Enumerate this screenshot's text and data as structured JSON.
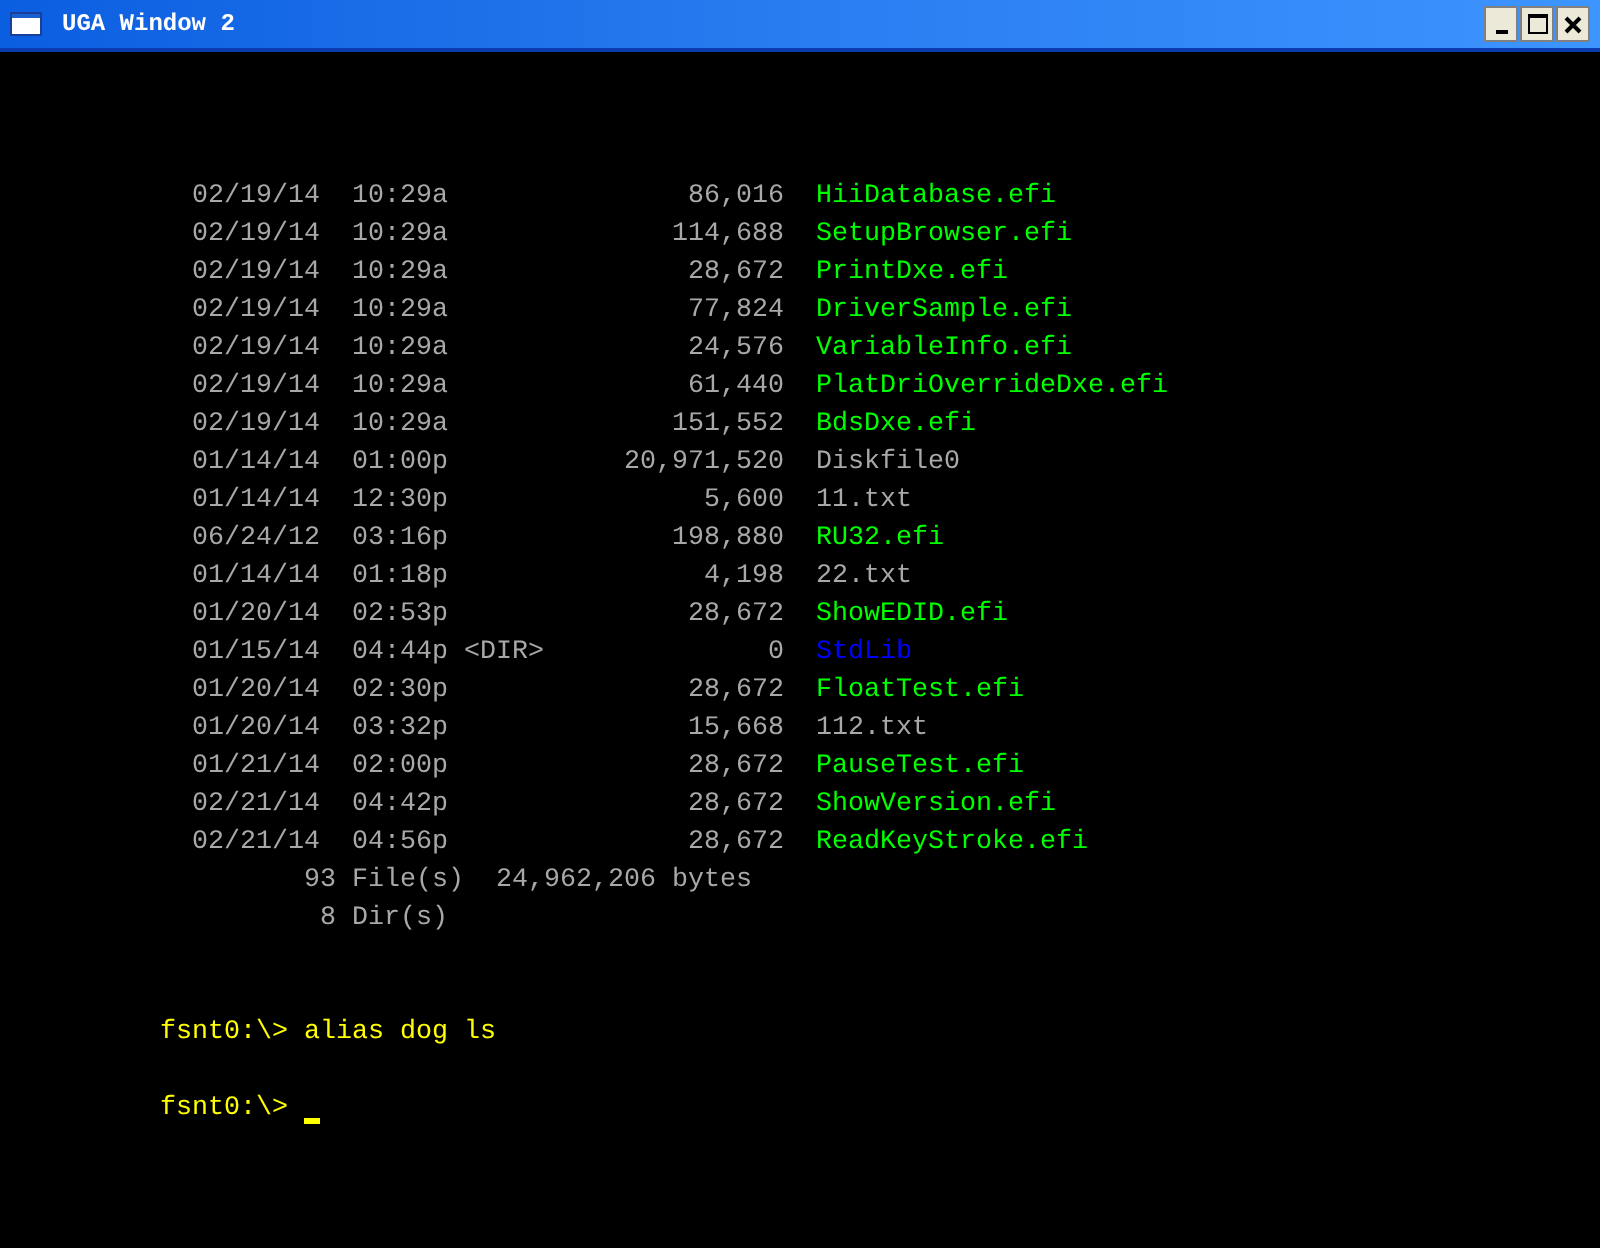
{
  "window": {
    "title": "UGA Window 2"
  },
  "listing": [
    {
      "date": "02/19/14",
      "time": "10:29a",
      "size": "86,016",
      "name": "HiiDatabase.efi",
      "kind": "executable"
    },
    {
      "date": "02/19/14",
      "time": "10:29a",
      "size": "114,688",
      "name": "SetupBrowser.efi",
      "kind": "executable"
    },
    {
      "date": "02/19/14",
      "time": "10:29a",
      "size": "28,672",
      "name": "PrintDxe.efi",
      "kind": "executable"
    },
    {
      "date": "02/19/14",
      "time": "10:29a",
      "size": "77,824",
      "name": "DriverSample.efi",
      "kind": "executable"
    },
    {
      "date": "02/19/14",
      "time": "10:29a",
      "size": "24,576",
      "name": "VariableInfo.efi",
      "kind": "executable"
    },
    {
      "date": "02/19/14",
      "time": "10:29a",
      "size": "61,440",
      "name": "PlatDriOverrideDxe.efi",
      "kind": "executable"
    },
    {
      "date": "02/19/14",
      "time": "10:29a",
      "size": "151,552",
      "name": "BdsDxe.efi",
      "kind": "executable"
    },
    {
      "date": "01/14/14",
      "time": "01:00p",
      "size": "20,971,520",
      "name": "Diskfile0",
      "kind": "file"
    },
    {
      "date": "01/14/14",
      "time": "12:30p",
      "size": "5,600",
      "name": "11.txt",
      "kind": "file"
    },
    {
      "date": "06/24/12",
      "time": "03:16p",
      "size": "198,880",
      "name": "RU32.efi",
      "kind": "executable"
    },
    {
      "date": "01/14/14",
      "time": "01:18p",
      "size": "4,198",
      "name": "22.txt",
      "kind": "file"
    },
    {
      "date": "01/20/14",
      "time": "02:53p",
      "size": "28,672",
      "name": "ShowEDID.efi",
      "kind": "executable"
    },
    {
      "date": "01/15/14",
      "time": "04:44p",
      "dir_tag": "<DIR>",
      "size": "0",
      "name": "StdLib",
      "kind": "directory"
    },
    {
      "date": "01/20/14",
      "time": "02:30p",
      "size": "28,672",
      "name": "FloatTest.efi",
      "kind": "executable"
    },
    {
      "date": "01/20/14",
      "time": "03:32p",
      "size": "15,668",
      "name": "112.txt",
      "kind": "file"
    },
    {
      "date": "01/21/14",
      "time": "02:00p",
      "size": "28,672",
      "name": "PauseTest.efi",
      "kind": "executable"
    },
    {
      "date": "02/21/14",
      "time": "04:42p",
      "size": "28,672",
      "name": "ShowVersion.efi",
      "kind": "executable"
    },
    {
      "date": "02/21/14",
      "time": "04:56p",
      "size": "28,672",
      "name": "ReadKeyStroke.efi",
      "kind": "executable"
    }
  ],
  "summary": [
    {
      "count": "93",
      "label": "File(s)",
      "bytes": "24,962,206",
      "unit": "bytes"
    },
    {
      "count": "8",
      "label": "Dir(s)"
    }
  ],
  "prompts": [
    {
      "prompt": "fsnt0:\\>",
      "command": "alias dog ls"
    },
    {
      "prompt": "fsnt0:\\>",
      "cursor": true
    }
  ]
}
